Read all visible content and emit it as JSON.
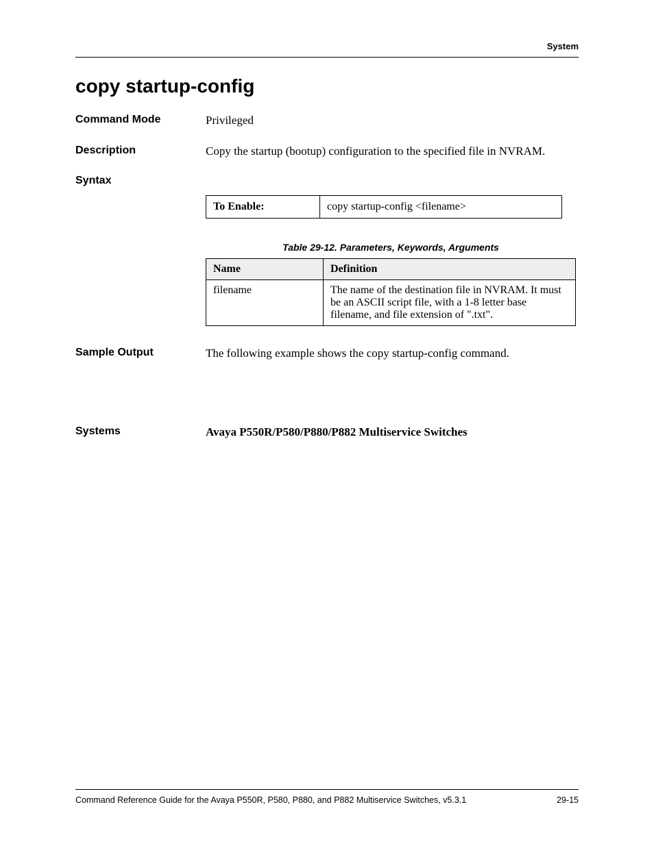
{
  "header": {
    "section": "System"
  },
  "title": "copy startup-config",
  "fields": {
    "command_mode_label": "Command Mode",
    "command_mode_value": "Privileged",
    "description_label": "Description",
    "description_value": "Copy the startup (bootup) configuration to the specified file in NVRAM.",
    "syntax_label": "Syntax",
    "sample_output_label": "Sample Output",
    "sample_output_value": "The following example shows the copy startup-config command.",
    "systems_label": "Systems",
    "systems_value": "Avaya P550R/P580/P880/P882 Multiservice Switches"
  },
  "syntax_table": {
    "enable_label": "To Enable:",
    "enable_value": "copy startup-config <filename>"
  },
  "param_table": {
    "caption": "Table 29-12.  Parameters, Keywords, Arguments",
    "headers": {
      "name": "Name",
      "definition": "Definition"
    },
    "rows": [
      {
        "name": "filename",
        "definition": "The name of the destination file in NVRAM. It must be an ASCII script file, with a 1-8 letter base filename, and file extension of \".txt\"."
      }
    ]
  },
  "footer": {
    "guide": "Command Reference Guide for the Avaya P550R, P580, P880, and P882 Multiservice Switches, v5.3.1",
    "page": "29-15"
  }
}
